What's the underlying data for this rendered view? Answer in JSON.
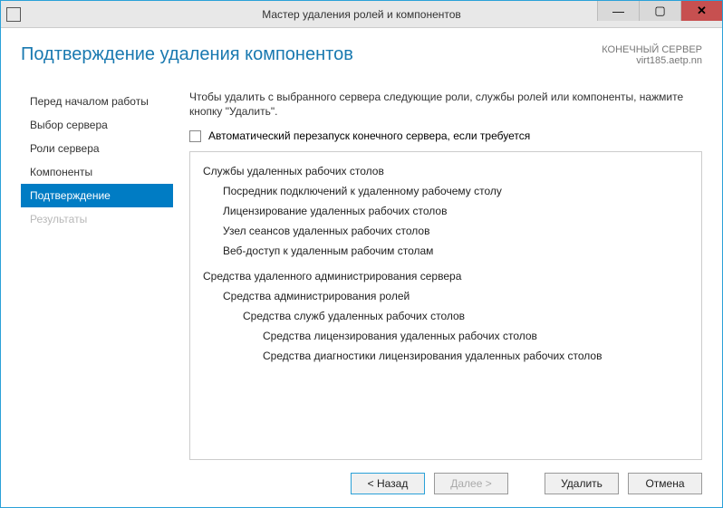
{
  "window": {
    "title": "Мастер удаления ролей и компонентов"
  },
  "header": {
    "page_title": "Подтверждение удаления компонентов",
    "server_label": "КОНЕЧНЫЙ СЕРВЕР",
    "server_name": "virt185.aetp.nn"
  },
  "sidebar": {
    "items": [
      {
        "label": "Перед началом работы",
        "state": "normal"
      },
      {
        "label": "Выбор сервера",
        "state": "normal"
      },
      {
        "label": "Роли сервера",
        "state": "normal"
      },
      {
        "label": "Компоненты",
        "state": "normal"
      },
      {
        "label": "Подтверждение",
        "state": "active"
      },
      {
        "label": "Результаты",
        "state": "disabled"
      }
    ]
  },
  "main": {
    "intro": "Чтобы удалить с выбранного сервера следующие роли, службы ролей или компоненты, нажмите кнопку \"Удалить\".",
    "restart_checkbox_label": "Автоматический перезапуск конечного сервера, если требуется",
    "restart_checked": false,
    "tree": {
      "group1": "Службы удаленных рабочих столов",
      "group1_items": [
        "Посредник подключений к удаленному рабочему столу",
        "Лицензирование удаленных рабочих столов",
        "Узел сеансов удаленных рабочих столов",
        "Веб-доступ к удаленным рабочим столам"
      ],
      "group2": "Средства удаленного администрирования сервера",
      "group2_sub": "Средства администрирования ролей",
      "group2_subsub": "Средства служб удаленных рабочих столов",
      "group2_items": [
        "Средства лицензирования удаленных рабочих столов",
        "Средства диагностики лицензирования удаленных рабочих столов"
      ]
    }
  },
  "footer": {
    "back": "< Назад",
    "next": "Далее >",
    "remove": "Удалить",
    "cancel": "Отмена"
  }
}
